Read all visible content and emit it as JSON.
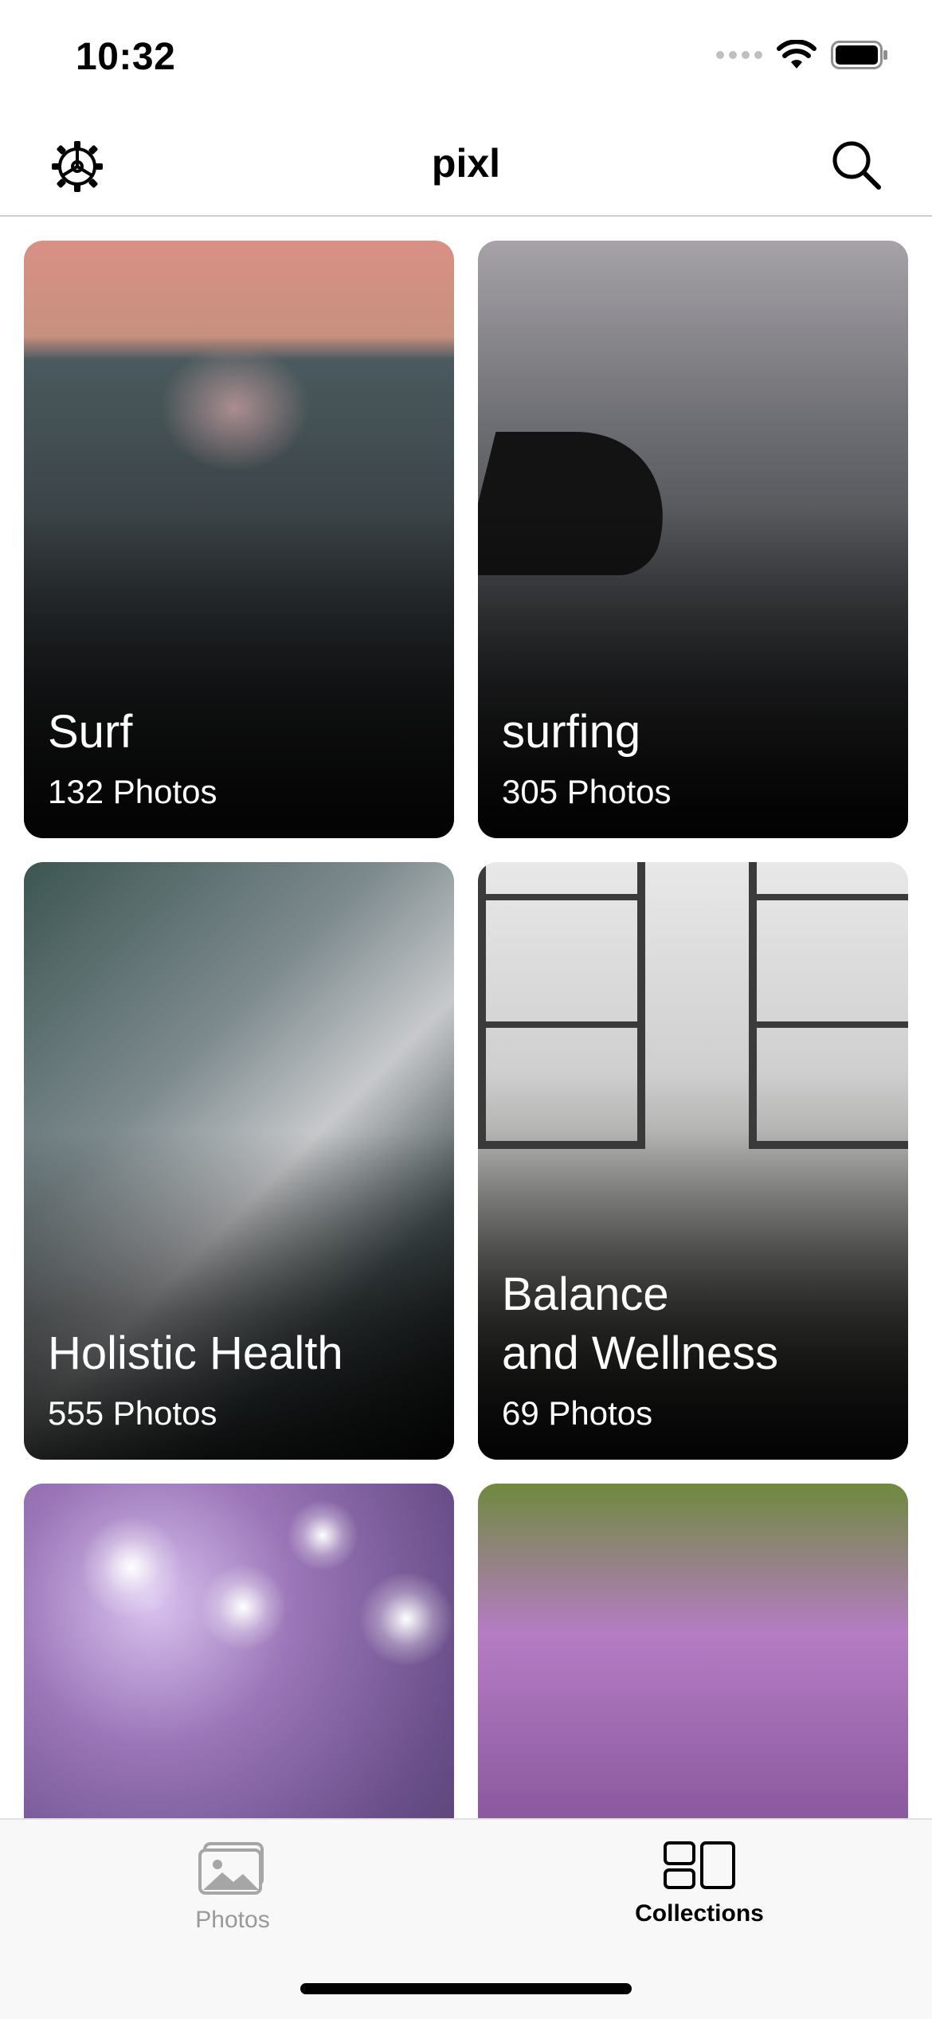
{
  "status_bar": {
    "time": "10:32",
    "signal_icon": "signal-icon",
    "wifi_icon": "wifi-icon",
    "battery_icon": "battery-icon"
  },
  "nav_bar": {
    "title": "pixl",
    "left_icon": "settings-gear-icon",
    "right_icon": "search-icon"
  },
  "collections": [
    {
      "title": "Surf",
      "count": "132 Photos"
    },
    {
      "title": "surfing",
      "count": "305 Photos"
    },
    {
      "title": "Holistic Health",
      "count": "555 Photos"
    },
    {
      "title_line1": "Balance",
      "title_line2": "and Wellness",
      "count": "69 Photos"
    },
    {
      "title": "",
      "count": ""
    },
    {
      "title": "",
      "count": ""
    }
  ],
  "tab_bar": {
    "photos_label": "Photos",
    "collections_label": "Collections",
    "selected": "Collections",
    "photos_icon": "photos-icon",
    "collections_icon": "collections-icon"
  }
}
